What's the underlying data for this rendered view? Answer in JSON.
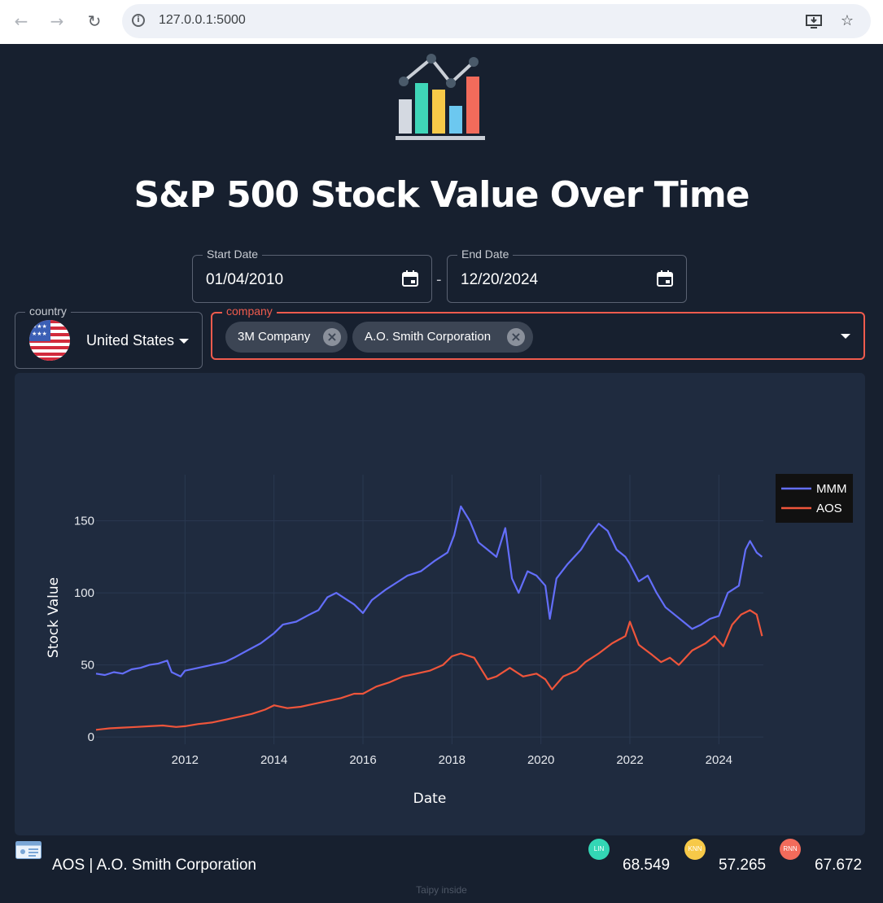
{
  "browser": {
    "url": "127.0.0.1:5000",
    "back_icon": "arrow-left-icon",
    "forward_icon": "arrow-right-icon",
    "reload_icon": "reload-icon",
    "install_icon": "install-app-icon",
    "bookmark_icon": "star-icon"
  },
  "page": {
    "title": "S&P 500 Stock Value Over Time",
    "logo_icon": "bar-line-chart-logo"
  },
  "filters": {
    "start_date": {
      "label": "Start Date",
      "value": "01/04/2010"
    },
    "separator": "-",
    "end_date": {
      "label": "End Date",
      "value": "12/20/2024"
    },
    "country": {
      "label": "country",
      "value": "United States",
      "flag_icon": "us-flag-icon"
    },
    "company": {
      "label": "company",
      "chips": [
        "3M Company",
        "A.O. Smith Corporation"
      ]
    }
  },
  "chart_data": {
    "type": "line",
    "xlabel": "Date",
    "ylabel": "Stock Value",
    "xlim": [
      2010.0,
      2025.0
    ],
    "ylim": [
      -5,
      182
    ],
    "x_ticks": [
      "2012",
      "2014",
      "2016",
      "2018",
      "2020",
      "2022",
      "2024"
    ],
    "y_ticks": [
      "0",
      "50",
      "100",
      "150"
    ],
    "legend_position": "top-right",
    "grid": true,
    "series": [
      {
        "name": "MMM",
        "color": "#636efa",
        "x": [
          2010.0,
          2010.2,
          2010.4,
          2010.6,
          2010.8,
          2011.0,
          2011.2,
          2011.4,
          2011.6,
          2011.7,
          2011.9,
          2012.0,
          2012.3,
          2012.6,
          2012.9,
          2013.1,
          2013.4,
          2013.7,
          2014.0,
          2014.2,
          2014.5,
          2014.8,
          2015.0,
          2015.2,
          2015.4,
          2015.6,
          2015.8,
          2016.0,
          2016.2,
          2016.5,
          2016.8,
          2017.0,
          2017.3,
          2017.6,
          2017.9,
          2018.05,
          2018.2,
          2018.4,
          2018.6,
          2018.8,
          2019.0,
          2019.2,
          2019.35,
          2019.5,
          2019.7,
          2019.9,
          2020.1,
          2020.2,
          2020.35,
          2020.6,
          2020.9,
          2021.1,
          2021.3,
          2021.5,
          2021.7,
          2021.9,
          2022.0,
          2022.2,
          2022.4,
          2022.6,
          2022.8,
          2023.0,
          2023.2,
          2023.4,
          2023.6,
          2023.8,
          2024.0,
          2024.2,
          2024.45,
          2024.6,
          2024.7,
          2024.85,
          2024.97
        ],
        "values": [
          44,
          43,
          45,
          44,
          47,
          48,
          50,
          51,
          53,
          45,
          42,
          46,
          48,
          50,
          52,
          55,
          60,
          65,
          72,
          78,
          80,
          85,
          88,
          97,
          100,
          96,
          92,
          86,
          95,
          102,
          108,
          112,
          115,
          122,
          128,
          140,
          160,
          150,
          135,
          130,
          125,
          145,
          110,
          100,
          115,
          112,
          105,
          82,
          110,
          120,
          130,
          140,
          148,
          143,
          130,
          125,
          120,
          108,
          112,
          100,
          90,
          85,
          80,
          75,
          78,
          82,
          84,
          100,
          105,
          130,
          136,
          128,
          125
        ]
      },
      {
        "name": "AOS",
        "color": "#ef553b",
        "x": [
          2010.0,
          2010.3,
          2010.6,
          2010.9,
          2011.2,
          2011.5,
          2011.8,
          2012.0,
          2012.3,
          2012.6,
          2012.9,
          2013.2,
          2013.5,
          2013.8,
          2014.0,
          2014.3,
          2014.6,
          2014.9,
          2015.2,
          2015.5,
          2015.8,
          2016.0,
          2016.3,
          2016.6,
          2016.9,
          2017.2,
          2017.5,
          2017.8,
          2018.0,
          2018.2,
          2018.5,
          2018.8,
          2019.0,
          2019.3,
          2019.6,
          2019.9,
          2020.1,
          2020.25,
          2020.5,
          2020.8,
          2021.0,
          2021.3,
          2021.6,
          2021.9,
          2022.0,
          2022.2,
          2022.5,
          2022.7,
          2022.9,
          2023.1,
          2023.4,
          2023.7,
          2023.9,
          2024.1,
          2024.3,
          2024.5,
          2024.7,
          2024.85,
          2024.97
        ],
        "values": [
          5,
          6,
          6.5,
          7,
          7.5,
          8,
          7,
          7.5,
          9,
          10,
          12,
          14,
          16,
          19,
          22,
          20,
          21,
          23,
          25,
          27,
          30,
          30,
          35,
          38,
          42,
          44,
          46,
          50,
          56,
          58,
          55,
          40,
          42,
          48,
          42,
          44,
          40,
          33,
          42,
          46,
          52,
          58,
          65,
          70,
          80,
          64,
          57,
          52,
          55,
          50,
          60,
          65,
          70,
          63,
          78,
          85,
          88,
          85,
          70
        ]
      }
    ]
  },
  "bottom": {
    "card_icon": "id-card-icon",
    "company_label": "AOS | A.O. Smith Corporation",
    "metrics": [
      {
        "badge": "LIN",
        "value": "68.549",
        "color": "#33d6b5"
      },
      {
        "badge": "KNN",
        "value": "57.265",
        "color": "#f7c948"
      },
      {
        "badge": "RNN",
        "value": "67.672",
        "color": "#f26b5b"
      }
    ]
  },
  "footer": "Taipy inside",
  "colors": {
    "background": "#17202f",
    "panel": "#1f2b3f",
    "accent": "#ef5b4d"
  }
}
